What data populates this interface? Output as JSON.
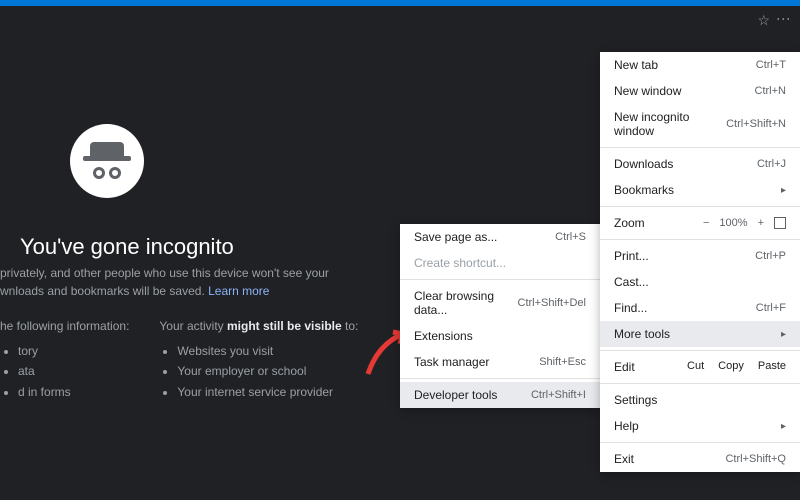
{
  "win": {
    "min": "—",
    "max": "▢",
    "close": "✕"
  },
  "page": {
    "title": "You've gone incognito",
    "para_pre": "privately, and other people who use this device won't see your",
    "para_line2": "wnloads and bookmarks will be saved. ",
    "learn_more": "Learn more",
    "col1": {
      "head": "he following information:",
      "items": [
        "tory",
        "ata",
        "d in forms"
      ]
    },
    "col2": {
      "head_pre": "Your activity ",
      "head_bold": "might still be visible",
      "head_post": " to:",
      "items": [
        "Websites you visit",
        "Your employer or school",
        "Your internet service provider"
      ]
    }
  },
  "menu1": {
    "newtab": {
      "label": "New tab",
      "sc": "Ctrl+T"
    },
    "newwin": {
      "label": "New window",
      "sc": "Ctrl+N"
    },
    "newinc": {
      "label": "New incognito window",
      "sc": "Ctrl+Shift+N"
    },
    "dl": {
      "label": "Downloads",
      "sc": "Ctrl+J"
    },
    "bm": {
      "label": "Bookmarks"
    },
    "zoom": {
      "label": "Zoom",
      "minus": "−",
      "val": "100%",
      "plus": "+"
    },
    "print": {
      "label": "Print...",
      "sc": "Ctrl+P"
    },
    "cast": {
      "label": "Cast..."
    },
    "find": {
      "label": "Find...",
      "sc": "Ctrl+F"
    },
    "more": {
      "label": "More tools"
    },
    "edit": {
      "label": "Edit",
      "cut": "Cut",
      "copy": "Copy",
      "paste": "Paste"
    },
    "settings": {
      "label": "Settings"
    },
    "help": {
      "label": "Help"
    },
    "exit": {
      "label": "Exit",
      "sc": "Ctrl+Shift+Q"
    }
  },
  "menu2": {
    "save": {
      "label": "Save page as...",
      "sc": "Ctrl+S"
    },
    "create": {
      "label": "Create shortcut..."
    },
    "clear": {
      "label": "Clear browsing data...",
      "sc": "Ctrl+Shift+Del"
    },
    "ext": {
      "label": "Extensions"
    },
    "task": {
      "label": "Task manager",
      "sc": "Shift+Esc"
    },
    "dev": {
      "label": "Developer tools",
      "sc": "Ctrl+Shift+I"
    }
  }
}
